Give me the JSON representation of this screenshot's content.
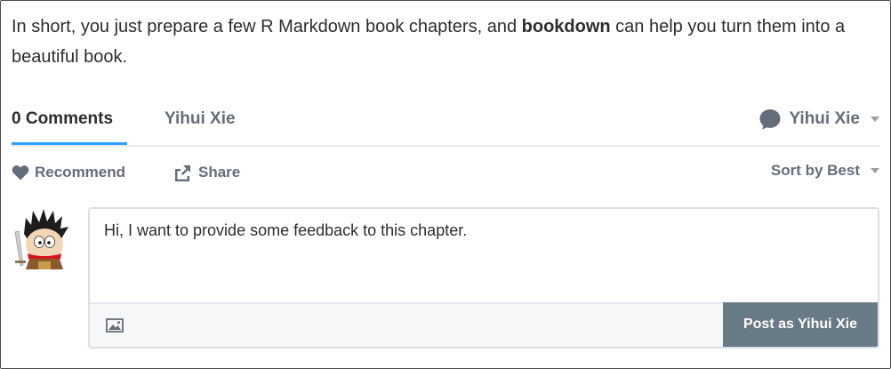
{
  "intro": {
    "before": "In short, you just prepare a few R Markdown book chapters, and ",
    "bold": "bookdown",
    "after": " can help you turn them into a beautiful book."
  },
  "tabs": {
    "comments_label": "0 Comments",
    "community_label": "Yihui Xie",
    "user_label": "Yihui Xie"
  },
  "actions": {
    "recommend_label": "Recommend",
    "share_label": "Share",
    "sort_label": "Sort by Best"
  },
  "editor": {
    "text": "Hi, I want to provide some feedback to this chapter.",
    "post_label": "Post as Yihui Xie"
  },
  "icons": {
    "bubble": "speech-bubble-icon",
    "heart": "heart-icon",
    "share": "share-icon",
    "image": "image-icon",
    "caret": "chevron-down-icon"
  },
  "colors": {
    "accent": "#2e9fff",
    "muted_text": "#656c7a",
    "post_button": "#687a86"
  }
}
